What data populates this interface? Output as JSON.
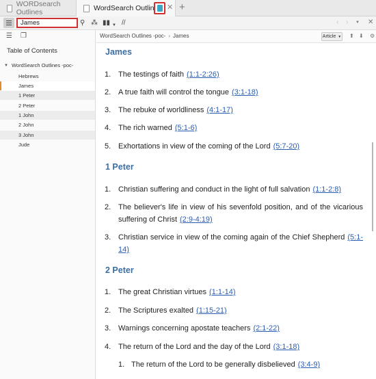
{
  "tabs": [
    {
      "title": "WORDsearch Outlines"
    },
    {
      "title": "WordSearch Outlines -poc-"
    }
  ],
  "toolbar": {
    "search_value": "James",
    "extra_label": "//"
  },
  "sidebar": {
    "heading": "Table of Contents",
    "root_label": "WordSearch Outlines -poc-",
    "items": [
      {
        "label": "Hebrews"
      },
      {
        "label": "James"
      },
      {
        "label": "1 Peter"
      },
      {
        "label": "2 Peter"
      },
      {
        "label": "1 John"
      },
      {
        "label": "2 John"
      },
      {
        "label": "3 John"
      },
      {
        "label": "Jude"
      }
    ]
  },
  "docbar": {
    "crumb_root": "WordSearch Outlines -poc-",
    "crumb_sep": "›",
    "crumb_current": "James",
    "view_label": "Article"
  },
  "content": {
    "sections": [
      {
        "title": "James",
        "items": [
          {
            "num": "1.",
            "text": "The testings of faith",
            "ref": "(1:1-2:26)"
          },
          {
            "num": "2.",
            "text": "A true faith will control the tongue",
            "ref": "(3:1-18)"
          },
          {
            "num": "3.",
            "text": "The rebuke of worldliness",
            "ref": "(4:1-17)"
          },
          {
            "num": "4.",
            "text": "The rich warned",
            "ref": "(5:1-6)"
          },
          {
            "num": "5.",
            "text": "Exhortations in view of the coming of the Lord",
            "ref": "(5:7-20)"
          }
        ]
      },
      {
        "title": "1 Peter",
        "items": [
          {
            "num": "1.",
            "text": "Christian suffering and conduct in the light of full salvation",
            "ref": "(1:1-2:8)"
          },
          {
            "num": "2.",
            "text": "The believer's life in view of his sevenfold position, and of the vicarious suffering of Christ",
            "ref": "(2:9-4:19)"
          },
          {
            "num": "3.",
            "text": "Christian service in view of the coming again of the Chief Shepherd",
            "ref": "(5:1-14)"
          }
        ]
      },
      {
        "title": "2 Peter",
        "items": [
          {
            "num": "1.",
            "text": "The great Christian virtues",
            "ref": "(1:1-14)"
          },
          {
            "num": "2.",
            "text": "The Scriptures exalted",
            "ref": "(1:15-21)"
          },
          {
            "num": "3.",
            "text": "Warnings concerning apostate teachers",
            "ref": "(2:1-22)"
          },
          {
            "num": "4.",
            "text": "The return of the Lord and the day of the Lord",
            "ref": "(3:1-18)"
          },
          {
            "num": "1.",
            "text": "The return of the Lord to be generally disbelieved",
            "ref": "(3:4-9)"
          }
        ]
      }
    ]
  }
}
